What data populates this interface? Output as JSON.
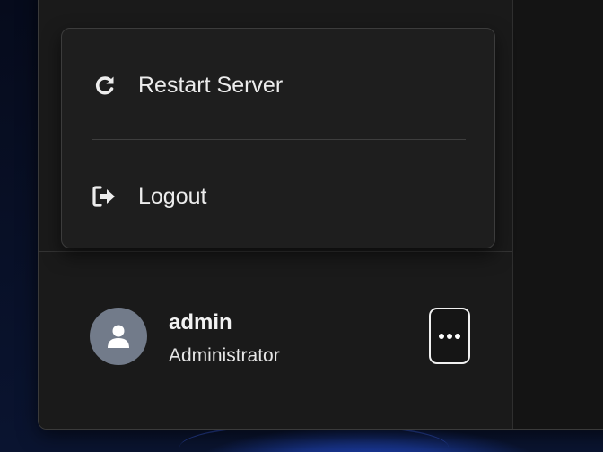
{
  "menu": {
    "items": [
      {
        "label": "Restart Server",
        "icon": "refresh-icon"
      },
      {
        "label": "Logout",
        "icon": "logout-icon"
      }
    ]
  },
  "user": {
    "name": "admin",
    "role": "Administrator",
    "avatar_icon": "user-icon",
    "more_icon": "ellipsis-icon"
  },
  "colors": {
    "window_bg": "#1a1a1a",
    "popup_bg": "#1e1e1e",
    "text": "#ececec",
    "avatar_bg": "#727b8a"
  }
}
